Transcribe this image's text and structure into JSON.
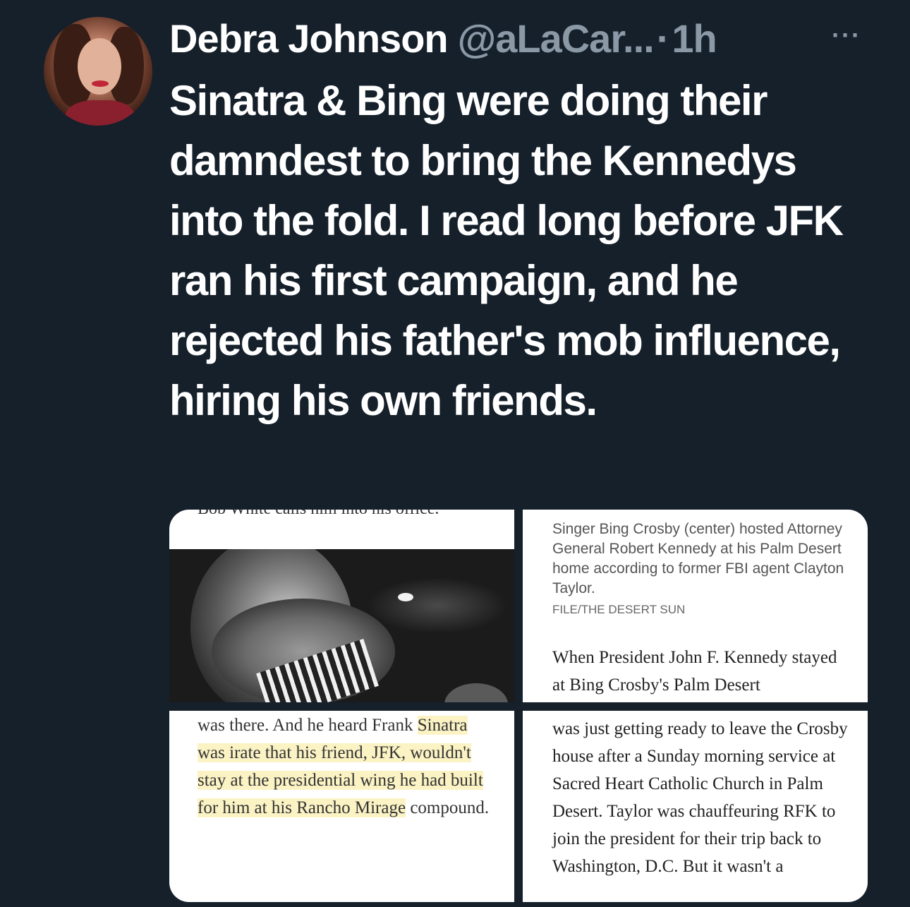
{
  "author": {
    "name": "Debra Johnson",
    "handle": "@aLaCar...",
    "separator": "·",
    "time": "1h"
  },
  "more_label": "···",
  "tweet_text": "Sinatra & Bing were doing their damndest to bring the Kennedys into the fold.  I read long before JFK ran his first campaign, and he rejected his father's mob influence, hiring his own friends.",
  "media": {
    "top_left_cut_text": "Bob White calls him into his office.",
    "top_right": {
      "caption": "Singer Bing Crosby (center) hosted Attorney General Robert Kennedy at his Palm Desert home according to former FBI agent Clayton Taylor.",
      "credit": "FILE/THE DESERT SUN",
      "article": "When President John F. Kennedy stayed at Bing Crosby's Palm Desert"
    },
    "bottom_left": {
      "line1": "was there. And he heard Frank",
      "highlighted": "Sinatra was irate that his friend, JFK, wouldn't stay at the presidential wing he had built for him at his Rancho Mirage",
      "line_end": "compound."
    },
    "bottom_right": {
      "article": "was just getting ready to leave the Crosby house after a Sunday morning service at Sacred Heart Catholic Church in Palm Desert. Taylor was chauffeuring RFK to join the president for their trip back to Washington, D.C. But it wasn't a"
    }
  },
  "colors": {
    "background": "#15202b",
    "text": "#ffffff",
    "secondary": "#8b98a5",
    "highlight": "#fbf3c4"
  }
}
